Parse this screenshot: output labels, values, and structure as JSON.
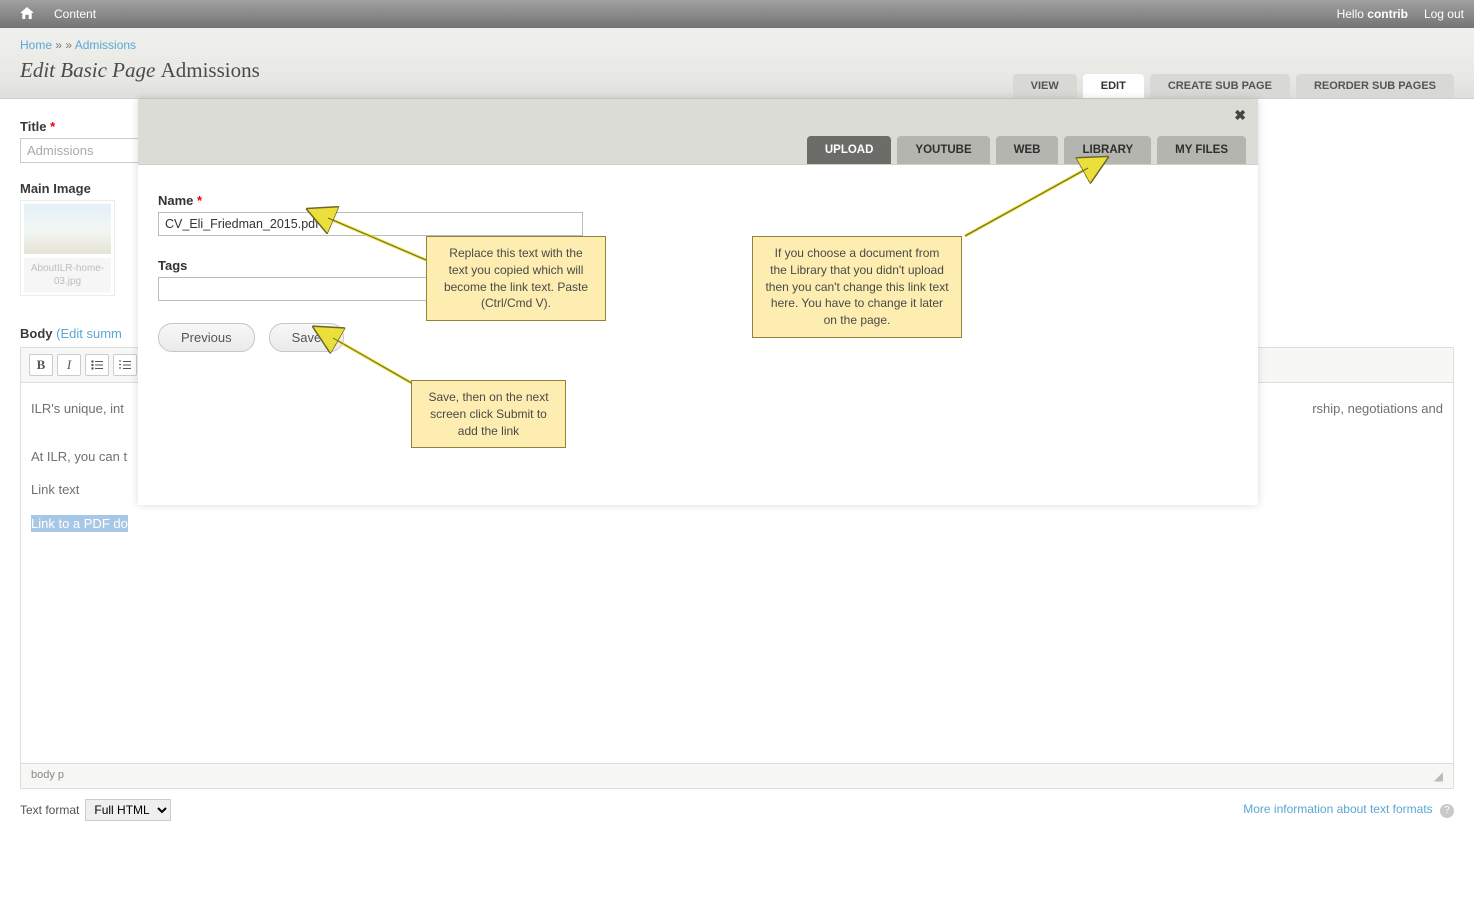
{
  "topbar": {
    "content_link": "Content",
    "hello_prefix": "Hello ",
    "username": "contrib",
    "logout": "Log out"
  },
  "breadcrumb": {
    "home": "Home",
    "sep1": " » » ",
    "current": "Admissions"
  },
  "page_title_prefix": "Edit Basic Page ",
  "page_title_entity": "Admissions",
  "page_tabs": {
    "view": "VIEW",
    "edit": "EDIT",
    "create_sub": "CREATE SUB PAGE",
    "reorder_sub": "REORDER SUB PAGES"
  },
  "fields": {
    "title_label": "Title",
    "title_value": "Admissions",
    "main_image_label": "Main Image",
    "thumb_caption": "AboutILR-home-03.jpg",
    "body_label": "Body",
    "edit_summary": "(Edit summ"
  },
  "wysiwyg": {
    "p1": "ILR's unique, int",
    "p1_tail": "rship, negotiations and",
    "p2": "At ILR, you can t",
    "p3": "Link text",
    "p4": "Link to a PDF do",
    "status_path": "body  p"
  },
  "text_format": {
    "label": "Text format",
    "value": "Full HTML",
    "more_info": "More information about text formats"
  },
  "modal": {
    "tabs": {
      "upload": "UPLOAD",
      "youtube": "YOUTUBE",
      "web": "WEB",
      "library": "LIBRARY",
      "myfiles": "MY FILES"
    },
    "name_label": "Name",
    "name_value": "CV_Eli_Friedman_2015.pdf",
    "tags_label": "Tags",
    "tags_value": "",
    "previous_btn": "Previous",
    "save_btn": "Save"
  },
  "annotations": {
    "replace_text": "Replace this text with the text you copied which will become the link text. Paste (Ctrl/Cmd V).",
    "library_note": "If you choose a document from the Library that you didn't upload then you can't change this link text here. You have to change it later on the page.",
    "save_note": "Save, then on the next screen click Submit to add the link"
  }
}
